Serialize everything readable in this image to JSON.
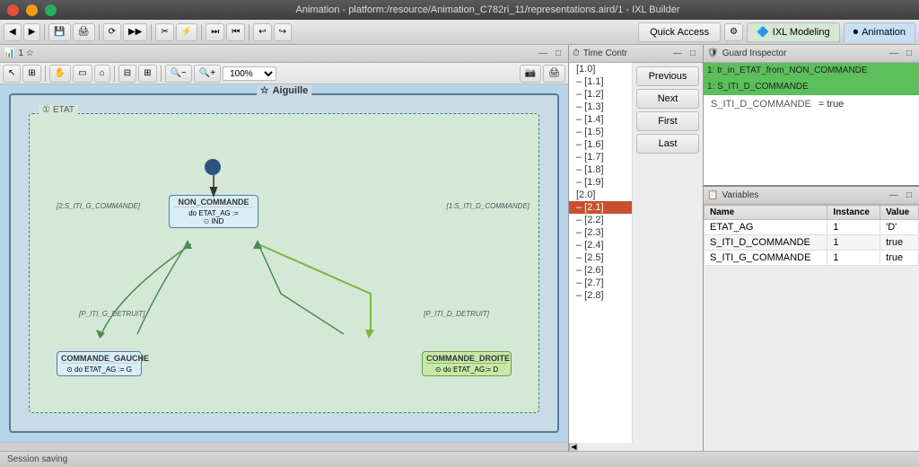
{
  "titlebar": {
    "title": "Animation - platform:/resource/Animation_C782ri_11/representations.aird/1 - IXL Builder"
  },
  "toolbar": {
    "quick_access_label": "Quick Access",
    "tab_ixl": "IXL Modeling",
    "tab_anim": "Animation"
  },
  "diagram_panel": {
    "title": "1 ☆",
    "view_title": "Aiguille",
    "inner_title": "ETAT",
    "zoom": "100%",
    "nodes": {
      "non_commande": "NON_COMMANDE",
      "non_commande_body": "do ETAT_AG :=\n⊙ IND",
      "commande_gauche": "COMMANDE_GAUCHE",
      "commande_gauche_body": "⊙ do ETAT_AG := G",
      "commande_droite": "COMMANDE_DROITE",
      "commande_droite_body": "⊙ do ETAT_AG:= D"
    },
    "edge_labels": {
      "e1": "[2:S_ITI_G_COMMANDE]",
      "e2": "[1:S_ITI_D_COMMANDE]",
      "e3": "[P_ITI_G_DETRUIT]",
      "e4": "[P_ITI_D_DETRUIT]"
    }
  },
  "time_controller": {
    "panel_title": "Time Contr",
    "items": [
      {
        "label": "[1.0]",
        "selected": false
      },
      {
        "label": "– [1.1]",
        "selected": false
      },
      {
        "label": "– [1.2]",
        "selected": false
      },
      {
        "label": "– [1.3]",
        "selected": false
      },
      {
        "label": "– [1.4]",
        "selected": false
      },
      {
        "label": "– [1.5]",
        "selected": false
      },
      {
        "label": "– [1.6]",
        "selected": false
      },
      {
        "label": "– [1.7]",
        "selected": false
      },
      {
        "label": "– [1.8]",
        "selected": false
      },
      {
        "label": "– [1.9]",
        "selected": false
      },
      {
        "label": "[2.0]",
        "selected": false
      },
      {
        "label": "– [2.1]",
        "selected": true
      },
      {
        "label": "– [2.2]",
        "selected": false
      },
      {
        "label": "– [2.3]",
        "selected": false
      },
      {
        "label": "– [2.4]",
        "selected": false
      },
      {
        "label": "– [2.5]",
        "selected": false
      },
      {
        "label": "– [2.6]",
        "selected": false
      },
      {
        "label": "– [2.7]",
        "selected": false
      },
      {
        "label": "– [2.8]",
        "selected": false
      }
    ],
    "buttons": {
      "previous": "Previous",
      "next": "Next",
      "first": "First",
      "last": "Last"
    }
  },
  "guard_inspector": {
    "panel_title": "Guard Inspector",
    "selected_line1": "1: tr_in_ETAT_from_NON_COMMANDE",
    "selected_line2": "1: S_ITI_D_COMMANDE",
    "var_name": "S_ITI_D_COMMANDE",
    "var_value": "= true"
  },
  "variables": {
    "panel_title": "Variables",
    "columns": [
      "Name",
      "Instance",
      "Value"
    ],
    "rows": [
      {
        "name": "ETAT_AG",
        "instance": "1",
        "value": "'D'"
      },
      {
        "name": "S_ITI_D_COMMANDE",
        "instance": "1",
        "value": "true"
      },
      {
        "name": "S_ITI_G_COMMANDE",
        "instance": "1",
        "value": "true"
      }
    ]
  },
  "statusbar": {
    "text": "Session saving"
  }
}
